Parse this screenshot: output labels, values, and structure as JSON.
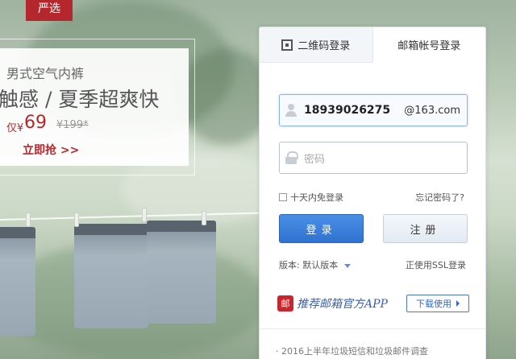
{
  "brand": {
    "label": "严选"
  },
  "promo": {
    "subtitle": "男式空气内裤",
    "headline": "触感 / 夏季超爽快",
    "price_prefix": "仅¥",
    "price": "69",
    "old_price": "¥199*",
    "cta": "立即抢 >>"
  },
  "login": {
    "tabs": [
      {
        "label": "二维码登录",
        "icon": "qr-code-icon"
      },
      {
        "label": "邮箱帐号登录"
      }
    ],
    "username": {
      "value": "18939026275",
      "suffix": "@163.com"
    },
    "password": {
      "placeholder": "密码"
    },
    "remember_label": "十天内免登录",
    "forgot_label": "忘记密码了?",
    "login_button": "登录",
    "register_button": "注册",
    "version_label": "版本:",
    "version_value": "默认版本",
    "ssl_label": "正使用SSL登录",
    "app_badge": "邮",
    "app_promo": "推荐邮箱官方APP",
    "download_button": "下载使用",
    "news": "· 2016上半年垃圾短信和垃圾邮件调查"
  }
}
